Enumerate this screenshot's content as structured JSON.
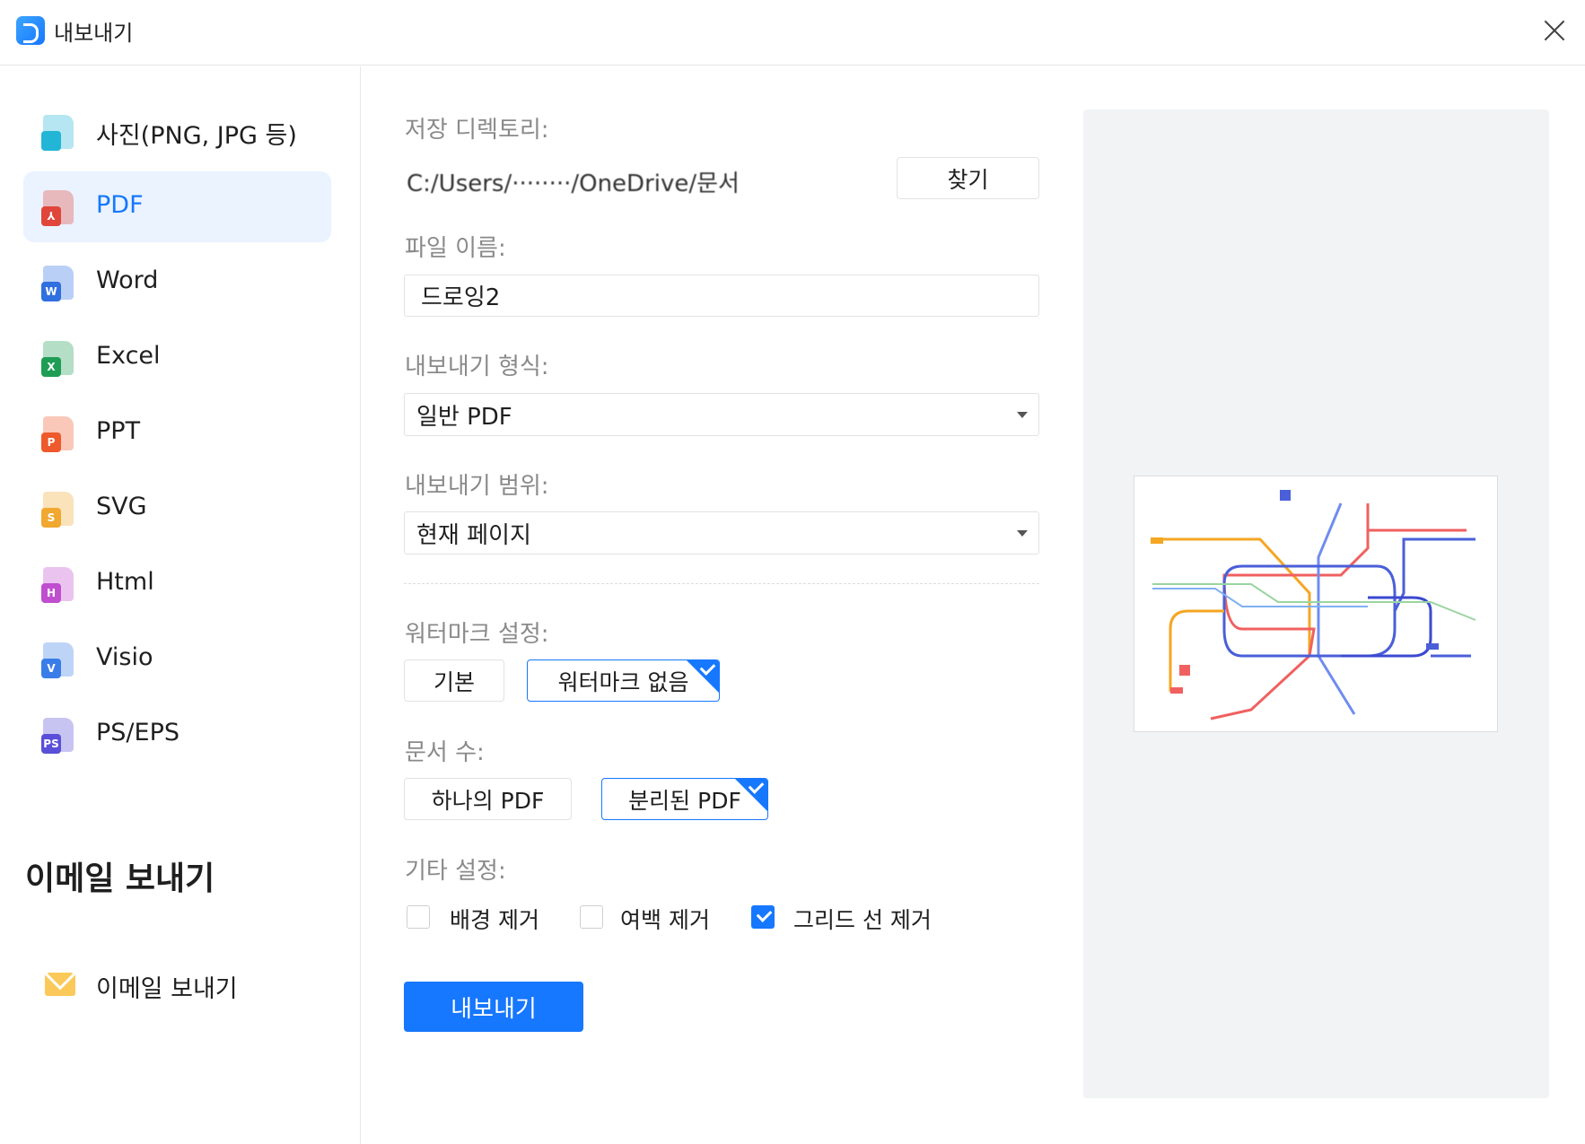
{
  "window": {
    "title": "내보내기"
  },
  "sidebar": {
    "items": [
      {
        "label": "사진(PNG, JPG 등)",
        "icon": "image-file-icon",
        "color": "#22b5d6",
        "letter": ""
      },
      {
        "label": "PDF",
        "icon": "pdf-file-icon",
        "color": "#e0463a",
        "letter": "⅄",
        "selected": true
      },
      {
        "label": "Word",
        "icon": "word-file-icon",
        "color": "#2f6fe0",
        "letter": "W"
      },
      {
        "label": "Excel",
        "icon": "excel-file-icon",
        "color": "#1f9d55",
        "letter": "X"
      },
      {
        "label": "PPT",
        "icon": "ppt-file-icon",
        "color": "#ee5a2c",
        "letter": "P"
      },
      {
        "label": "SVG",
        "icon": "svg-file-icon",
        "color": "#f0a830",
        "letter": "S"
      },
      {
        "label": "Html",
        "icon": "html-file-icon",
        "color": "#c04fd0",
        "letter": "H"
      },
      {
        "label": "Visio",
        "icon": "visio-file-icon",
        "color": "#3a7de8",
        "letter": "V"
      },
      {
        "label": "PS/EPS",
        "icon": "ps-file-icon",
        "color": "#5a4fd8",
        "letter": "PS"
      }
    ],
    "email_heading": "이메일 보내기",
    "email_item": "이메일 보내기"
  },
  "form": {
    "dir_label": "저장 디렉토리:",
    "dir_value": "C:/Users/········/OneDrive/문서",
    "browse": "찾기",
    "filename_label": "파일 이름:",
    "filename_value": "드로잉2",
    "format_label": "내보내기 형식:",
    "format_value": "일반 PDF",
    "range_label": "내보내기 범위:",
    "range_value": "현재 페이지",
    "watermark_label": "워터마크 설정:",
    "watermark_options": [
      "기본",
      "워터마크 없음"
    ],
    "watermark_selected": 1,
    "doccount_label": "문서 수:",
    "doccount_options": [
      "하나의 PDF",
      "분리된 PDF"
    ],
    "doccount_selected": 1,
    "other_label": "기타 설정:",
    "checkboxes": [
      {
        "label": "배경 제거",
        "checked": false
      },
      {
        "label": "여백 제거",
        "checked": false
      },
      {
        "label": "그리드 선 제거",
        "checked": true
      }
    ],
    "export": "내보내기"
  },
  "colors": {
    "accent": "#1677ff"
  }
}
